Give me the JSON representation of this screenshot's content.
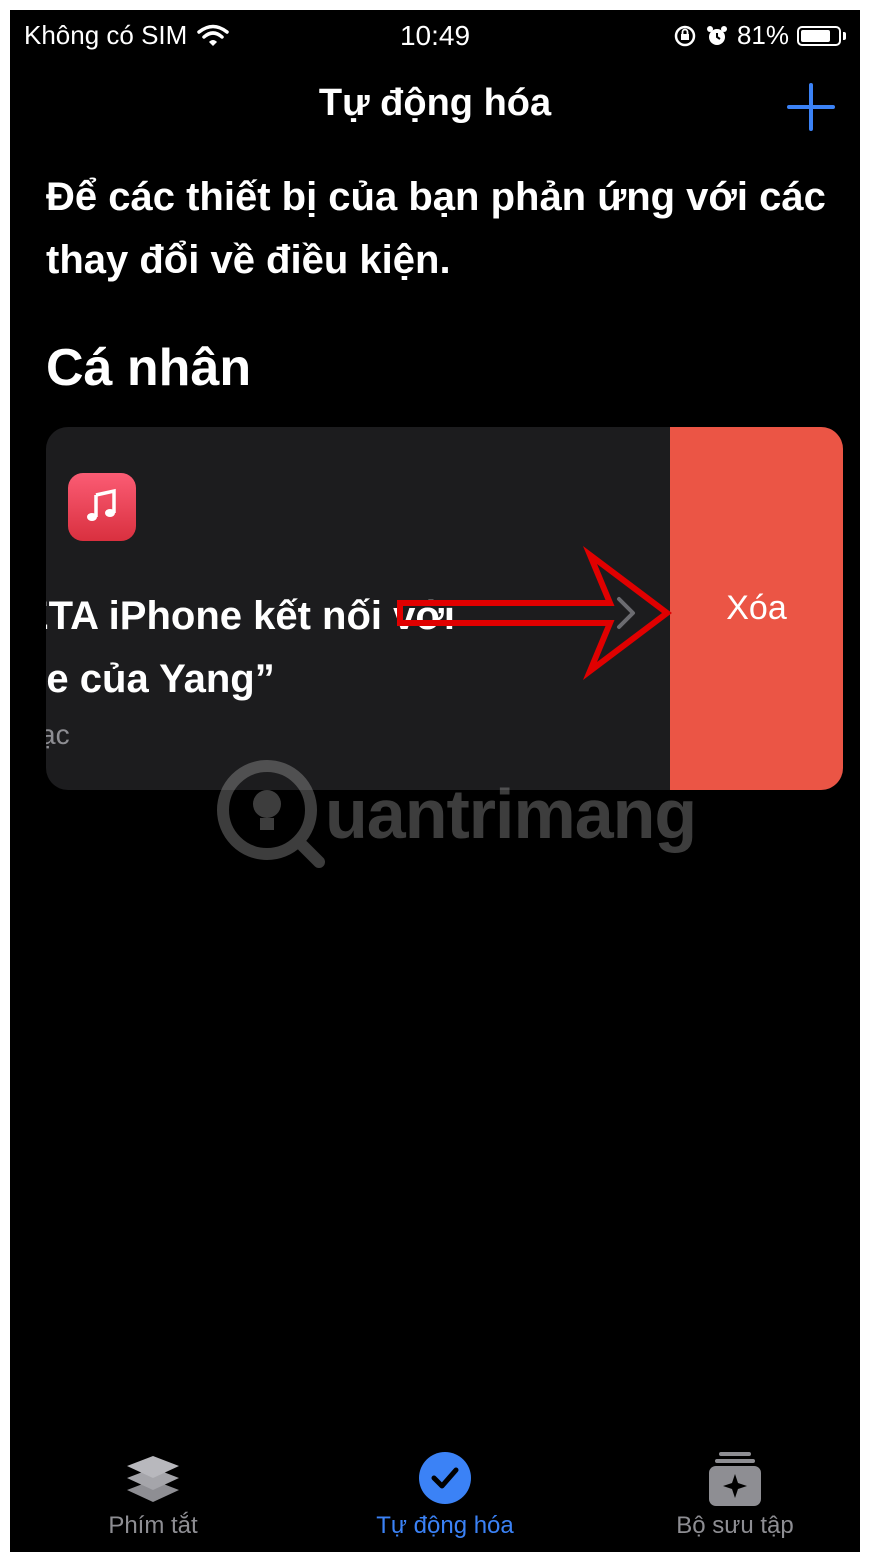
{
  "status_bar": {
    "carrier": "Không có SIM",
    "time": "10:49",
    "battery_percent": "81%",
    "battery_level": 0.81,
    "icons": [
      "wifi-icon",
      "rotation-lock-icon",
      "alarm-icon",
      "battery-icon"
    ]
  },
  "nav": {
    "title": "Tự động hóa",
    "add_icon": "plus-icon"
  },
  "subtitle": "Để các thiết bị của bạn phản ứng với các thay đổi về điều kiện.",
  "section": {
    "title": "Cá nhân"
  },
  "automation_card": {
    "icon": "music-app-icon",
    "title": "ETA iPhone kết nối với\nne của Yang”",
    "subtitle": "ạc",
    "delete_label": "Xóa"
  },
  "watermark": {
    "text": "uantrimang"
  },
  "tab_bar": {
    "tabs": [
      {
        "label": "Phím tắt",
        "icon": "layers-icon",
        "active": false
      },
      {
        "label": "Tự động hóa",
        "icon": "clock-check-icon",
        "active": true
      },
      {
        "label": "Bộ sưu tập",
        "icon": "gallery-icon",
        "active": false
      }
    ]
  },
  "colors": {
    "background": "#000000",
    "card": "#1c1c1e",
    "delete": "#eb5545",
    "accent": "#3b82f6",
    "annotation_arrow": "#e00000"
  }
}
